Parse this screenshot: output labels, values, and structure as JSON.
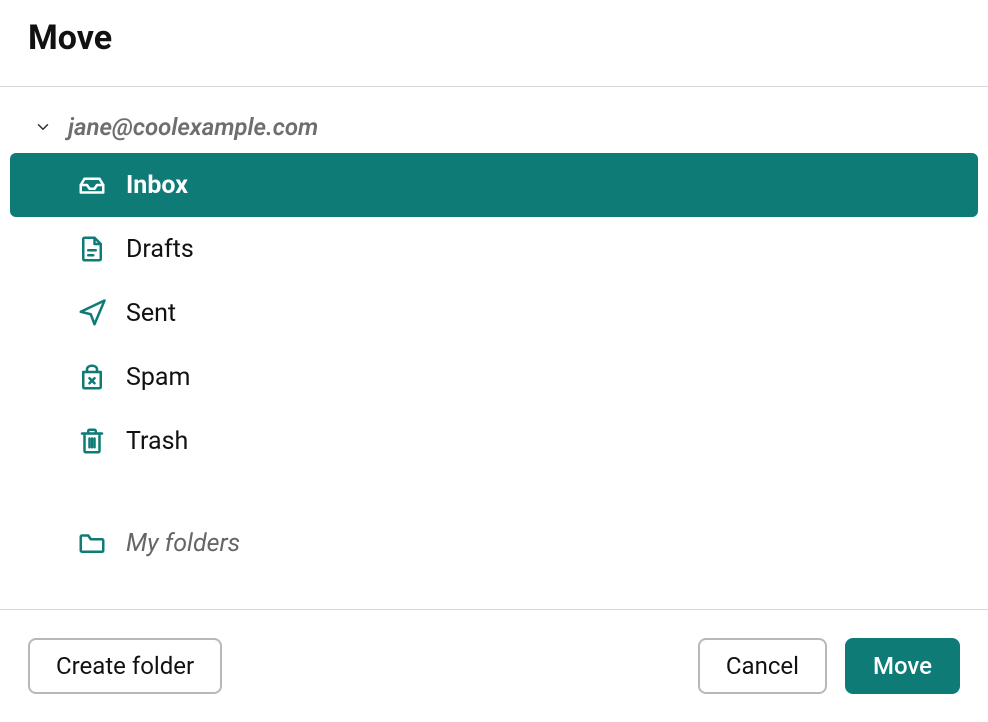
{
  "dialog": {
    "title": "Move"
  },
  "account": {
    "email": "jane@coolexample.com"
  },
  "folders": {
    "inbox": "Inbox",
    "drafts": "Drafts",
    "sent": "Sent",
    "spam": "Spam",
    "trash": "Trash",
    "myfolders": "My folders"
  },
  "footer": {
    "create_folder": "Create folder",
    "cancel": "Cancel",
    "move": "Move"
  },
  "colors": {
    "accent": "#0e7b77"
  }
}
